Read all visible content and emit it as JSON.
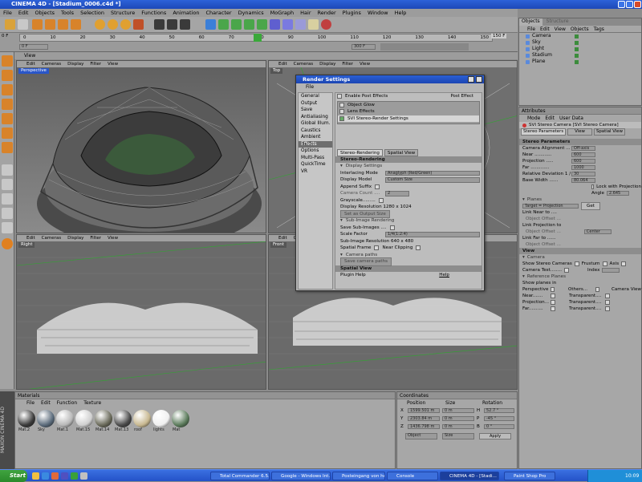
{
  "window": {
    "title": "CINEMA 4D - [Stadium_0006.c4d *]"
  },
  "menubar": [
    "File",
    "Edit",
    "Objects",
    "Tools",
    "Selection",
    "Structure",
    "Functions",
    "Animation",
    "Character",
    "Dynamics",
    "MoGraph",
    "Hair",
    "Render",
    "Plugins",
    "Window",
    "Help"
  ],
  "timeline": {
    "ticks": [
      "0",
      "10",
      "20",
      "30",
      "40",
      "50",
      "60",
      "70",
      "80",
      "90",
      "100",
      "110",
      "120",
      "130",
      "140",
      "150"
    ],
    "start": "0 F",
    "end": "150 F",
    "field_left": "0 F",
    "field_right": "300 F"
  },
  "viewports": [
    {
      "label": "Perspective",
      "menu": [
        "Edit",
        "Cameras",
        "Display",
        "Filter",
        "View"
      ]
    },
    {
      "label": "Top",
      "menu": [
        "Edit",
        "Cameras",
        "Display",
        "Filter",
        "View"
      ]
    },
    {
      "label": "Right",
      "menu": [
        "Edit",
        "Cameras",
        "Display",
        "Filter",
        "View"
      ]
    },
    {
      "label": "Front",
      "menu": [
        "Edit",
        "Cameras",
        "Display",
        "Filter",
        "View"
      ]
    }
  ],
  "viewport_header": "View",
  "objects_panel": {
    "tabs": [
      "Objects",
      "Structure"
    ],
    "menu": [
      "File",
      "Edit",
      "View",
      "Objects",
      "Tags"
    ],
    "items": [
      {
        "name": "Camera",
        "color": "#3c8c3c"
      },
      {
        "name": "Sky",
        "color": "#3c8c3c"
      },
      {
        "name": "Light",
        "color": "#3c8c3c"
      },
      {
        "name": "Stadium",
        "color": "#3c8c3c"
      },
      {
        "name": "Plane",
        "color": "#3c8c3c"
      }
    ]
  },
  "attributes_panel": {
    "title": "Attributes",
    "menu": [
      "Mode",
      "Edit",
      "User Data"
    ],
    "object": "SVI Stereo Camera [SVI Stereo Camera]",
    "tabs": [
      "Stereo Parameters",
      "View",
      "Spatial View"
    ],
    "section_stereo": "Stereo Parameters",
    "rows": [
      {
        "label": "Camera Alignment ...",
        "value": "Off-axis"
      },
      {
        "label": "Near ............",
        "value": "600"
      },
      {
        "label": "Projection .....",
        "value": "600"
      },
      {
        "label": "Far .............",
        "value": "1000"
      },
      {
        "label": "Relative Deviation 1 /",
        "value": "30"
      },
      {
        "label": "Base Width ......",
        "value": "80.064"
      }
    ],
    "lock_label": "Lock with Projection",
    "angle_label": "Angle",
    "angle_value": "2.645",
    "planes_label": "Planes",
    "target_value": "Target = Projection",
    "get_label": "Get",
    "link_near": "Link Near to ....",
    "object_offset": "Object Offset ...",
    "link_projection": "Link Projection to",
    "center_value": "Center",
    "link_far": "Link Far to ......",
    "section_view": "View",
    "camera_sub": "Camera",
    "show_stereo": "Show Stereo Cameras",
    "frustum": "Frustum",
    "axis": "Axis",
    "camera_test": "Camera Test........",
    "index_label": "Index",
    "reference_planes": "Reference Planes",
    "show_planes_in": "Show planes in",
    "plane_rows": [
      {
        "label": "Perspective",
        "mid": "Others...",
        "right": "Camera View"
      },
      {
        "label": "Near.......",
        "mid": "Transparent...."
      },
      {
        "label": "Projection...",
        "mid": "Transparent...."
      },
      {
        "label": "Far..........",
        "mid": "Transparent...."
      }
    ]
  },
  "render_dialog": {
    "title": "Render Settings",
    "menu": "File",
    "nav": [
      "General",
      "Output",
      "Save",
      "Antialiasing",
      "Global Illum.",
      "Caustics",
      "Ambient Occl.",
      "Effects",
      "Options",
      "Multi-Pass",
      "QuickTime VR"
    ],
    "selected_nav": "Effects",
    "enable_post": "Enable Post Effects",
    "post_effect_btn": "Post Effect",
    "effects": [
      "Object Glow",
      "Lens Effects",
      "SVI Stereo-Render Settings"
    ],
    "tabs": [
      "Stereo-Rendering",
      "Spatial View"
    ],
    "section": "Stereo-Rendering",
    "display_settings": "Display Settings",
    "rows": [
      {
        "label": "Interlacing Mode",
        "value": "Anaglyph (Red/Green)"
      },
      {
        "label": "Display Model",
        "value": "Custom Size"
      }
    ],
    "append_suffix": "Append Suffix",
    "camera_count": "Camera Count ....",
    "camera_count_value": "2",
    "grayscale": "Grayscale.........",
    "display_res": "Display Resolution  1280 x 1024",
    "set_output": "Set as Output Size",
    "sub_image": "Sub-Image Rendering",
    "save_sub": "Save Sub-Images ....",
    "scale_factor": "Scale Factor",
    "scale_value": "1/4(1:2:4)",
    "sub_res": "Sub-Image Resolution  640 x 480",
    "spatial_frame": "Spatial Frame",
    "near_clipping": "Near Clipping",
    "camera_paths": "Camera paths",
    "save_camera_paths": "Save camera paths",
    "spatial_view": "Spatial View",
    "plugin_help": "Plugin Help",
    "help": "Help"
  },
  "materials": {
    "title": "Materials",
    "menu": [
      "File",
      "Edit",
      "Function",
      "Texture"
    ],
    "items": [
      "Mat.2",
      "Sky",
      "Mat.1",
      "Mat.15",
      "Mat.14",
      "Mat.13",
      "roof",
      "lights",
      "Mat"
    ]
  },
  "coordinates": {
    "title": "Coordinates",
    "headers": [
      "Position",
      "Size",
      "Rotation"
    ],
    "rows": [
      {
        "axis": "X",
        "pos": "1599.501 m",
        "size": "0 m",
        "rot_axis": "H",
        "rot": "52.7 °"
      },
      {
        "axis": "Y",
        "pos": "2303.84 m",
        "size": "0 m",
        "rot_axis": "P",
        "rot": "-45 °"
      },
      {
        "axis": "Z",
        "pos": "1436.798 m",
        "size": "0 m",
        "rot_axis": "B",
        "rot": "0 °"
      }
    ],
    "object_btn": "Object",
    "size_btn": "Size",
    "apply_btn": "Apply"
  },
  "taskbar": {
    "start": "Start",
    "tasks": [
      "Total Commander 6.5...",
      "Google - Windows Int...",
      "Posteingang von hein...",
      "Console",
      "CINEMA 4D - [Stadi...",
      "Paint Shop Pro"
    ],
    "active": "CINEMA 4D - [Stadi...",
    "clock": "10:09"
  },
  "maxon_logo": "MAXON CINEMA 4D"
}
